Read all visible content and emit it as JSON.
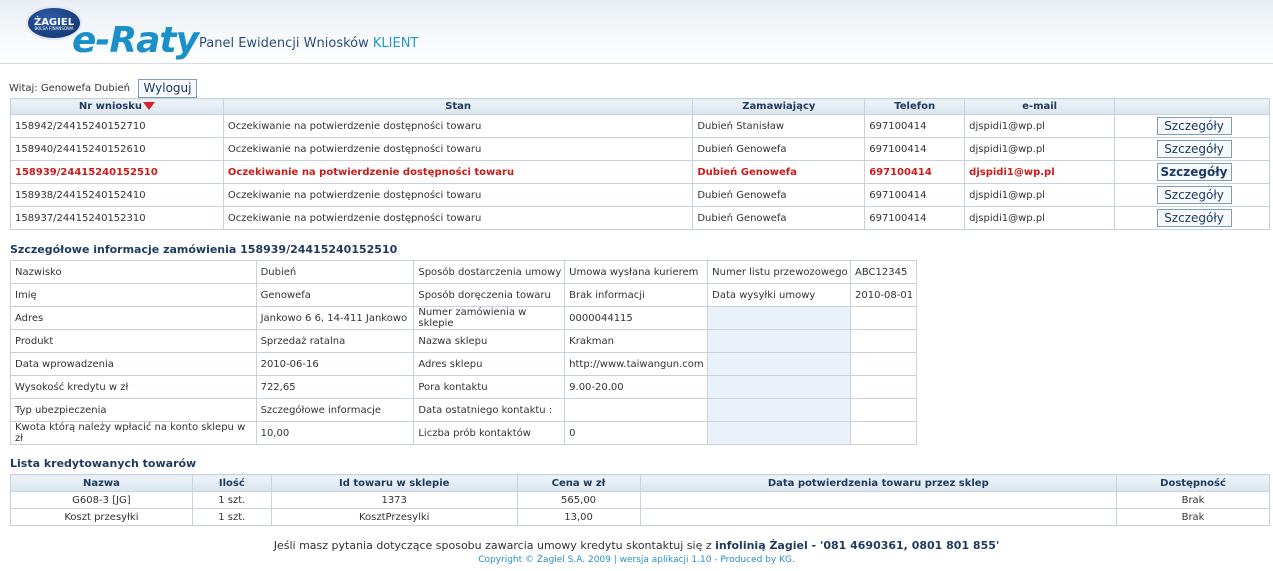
{
  "header": {
    "logo_text": "ŻAGIEL",
    "logo_subtext": "BOLSA FINANSOWA",
    "brand": "e-Raty",
    "panel_title": "Panel Ewidencji Wniosków",
    "panel_title_highlight": "KLIENT"
  },
  "welcome": {
    "text": "Witaj: Genowefa Dubień",
    "logout_label": "Wyloguj"
  },
  "orders": {
    "columns": [
      "Nr wniosku",
      "Stan",
      "Zamawiający",
      "Telefon",
      "e-mail",
      ""
    ],
    "details_label": "Szczegóły",
    "rows": [
      {
        "nr": "158942/24415240152710",
        "stan": "Oczekiwanie na potwierdzenie dostępności towaru",
        "zamawiajacy": "Dubień Stanisław",
        "telefon": "697100414",
        "email": "djspidi1@wp.pl"
      },
      {
        "nr": "158940/24415240152610",
        "stan": "Oczekiwanie na potwierdzenie dostępności towaru",
        "zamawiajacy": "Dubień Genowefa",
        "telefon": "697100414",
        "email": "djspidi1@wp.pl"
      },
      {
        "nr": "158939/24415240152510",
        "stan": "Oczekiwanie na potwierdzenie dostępności towaru",
        "zamawiajacy": "Dubień Genowefa",
        "telefon": "697100414",
        "email": "djspidi1@wp.pl"
      },
      {
        "nr": "158938/24415240152410",
        "stan": "Oczekiwanie na potwierdzenie dostępności towaru",
        "zamawiajacy": "Dubień Genowefa",
        "telefon": "697100414",
        "email": "djspidi1@wp.pl"
      },
      {
        "nr": "158937/24415240152310",
        "stan": "Oczekiwanie na potwierdzenie dostępności towaru",
        "zamawiajacy": "Dubień Genowefa",
        "telefon": "697100414",
        "email": "djspidi1@wp.pl"
      }
    ]
  },
  "details": {
    "title": "Szczegółowe informacje zamówienia 158939/24415240152510",
    "rows": [
      [
        "Nazwisko",
        "Dubień",
        "Sposób dostarczenia umowy",
        "Umowa wysłana kurierem",
        "Numer listu przewozowego",
        "ABC12345"
      ],
      [
        "Imię",
        "Genowefa",
        "Sposób doręczenia towaru",
        "Brak informacji",
        "Data wysyłki umowy",
        "2010-08-01"
      ],
      [
        "Adres",
        "Jankowo 6 6, 14-411 Jankowo",
        "Numer zamówienia w sklepie",
        "0000044115",
        "",
        ""
      ],
      [
        "Produkt",
        "Sprzedaż ratalna",
        "Nazwa sklepu",
        "Krakman",
        "",
        ""
      ],
      [
        "Data wprowadzenia",
        "2010-06-16",
        "Adres sklepu",
        "http://www.taiwangun.com",
        "",
        ""
      ],
      [
        "Wysokość kredytu w zł",
        "722,65",
        "Pora kontaktu",
        "9.00-20.00",
        "",
        ""
      ],
      [
        "Typ ubezpieczenia",
        "Szczegółowe informacje",
        "Data ostatniego kontaktu :",
        "",
        "",
        ""
      ],
      [
        "Kwota którą należy wpłacić na konto sklepu w zł",
        "10,00",
        "Liczba prób kontaktów",
        "0",
        "",
        ""
      ]
    ]
  },
  "goods": {
    "title": "Lista kredytowanych towarów",
    "columns": [
      "Nazwa",
      "Ilość",
      "Id towaru w sklepie",
      "Cena w zł",
      "Data potwierdzenia towaru przez sklep",
      "Dostępność"
    ],
    "rows": [
      [
        "G608-3 [JG]",
        "1 szt.",
        "1373",
        "565,00",
        "",
        "Brak"
      ],
      [
        "Koszt przesyłki",
        "1 szt.",
        "KosztPrzesylki",
        "13,00",
        "",
        "Brak"
      ]
    ]
  },
  "footer": {
    "text_before": "Jeśli masz pytania dotyczące sposobu zawarcia umowy kredytu skontaktuj się z",
    "text_bold": "infolinią Żagiel - '081 4690361, 0801 801 855'",
    "copyright": "Copyright © Żagiel S.A. 2009 | wersja aplikacji 1.10 - Produced by KG."
  },
  "colors": {
    "accent": "#1a8fc8",
    "highlight_row": "#cc1b1b",
    "link_red": "#b31b1b"
  }
}
